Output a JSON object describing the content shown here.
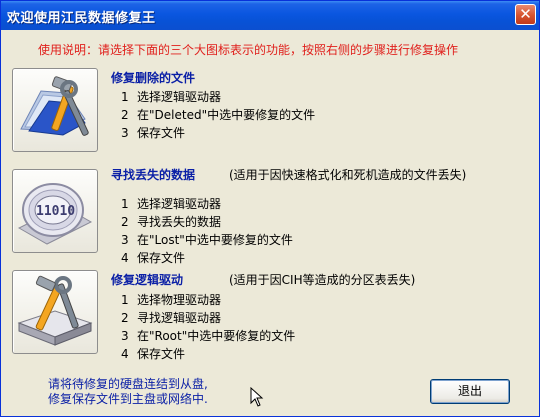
{
  "window": {
    "title": "欢迎使用江民数据修复王",
    "close_glyph": "✕",
    "title_color": "#0a56e0"
  },
  "instructions": "使用说明：请选择下面的三个大图标表示的功能，按照右侧的步骤进行修复操作",
  "sections": [
    {
      "icon": "file-recover-icon",
      "title": "修复删除的文件",
      "note": "",
      "steps": [
        {
          "num": "1",
          "text": "选择逻辑驱动器"
        },
        {
          "num": "2",
          "text": "在\"Deleted\"中选中要修复的文件"
        },
        {
          "num": "3",
          "text": "保存文件"
        }
      ]
    },
    {
      "icon": "disk-scan-icon",
      "title": "寻找丢失的数据",
      "note": "(适用于因快速格式化和死机造成的文件丢失)",
      "steps": [
        {
          "num": "1",
          "text": "选择逻辑驱动器"
        },
        {
          "num": "2",
          "text": "寻找丢失的数据"
        },
        {
          "num": "3",
          "text": "在\"Lost\"中选中要修复的文件"
        },
        {
          "num": "4",
          "text": "保存文件"
        }
      ]
    },
    {
      "icon": "drive-repair-icon",
      "title": "修复逻辑驱动",
      "note": "(适用于因CIH等造成的分区表丢失)",
      "steps": [
        {
          "num": "1",
          "text": "选择物理驱动器"
        },
        {
          "num": "2",
          "text": "寻找逻辑驱动器"
        },
        {
          "num": "3",
          "text": "在\"Root\"中选中要修复的文件"
        },
        {
          "num": "4",
          "text": "保存文件"
        }
      ]
    }
  ],
  "footer": {
    "line1": "请将待修复的硬盘连结到从盘,",
    "line2": "修复保存文件到主盘或网络中."
  },
  "exit_button": "退出"
}
